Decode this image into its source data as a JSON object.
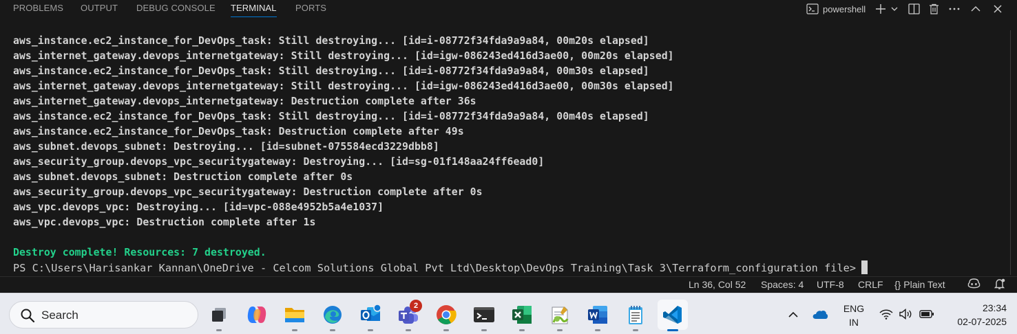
{
  "panel": {
    "tabs": [
      {
        "label": "PROBLEMS"
      },
      {
        "label": "OUTPUT"
      },
      {
        "label": "DEBUG CONSOLE"
      },
      {
        "label": "TERMINAL",
        "active": true
      },
      {
        "label": "PORTS"
      }
    ],
    "terminal_name": "powershell",
    "actions": [
      "terminal-icon",
      "plus-icon",
      "chevron-down-icon",
      "split-icon",
      "trash-icon",
      "ellipsis-icon",
      "chevron-up-icon",
      "close-icon"
    ]
  },
  "terminal": {
    "lines": [
      "aws_instance.ec2_instance_for_DevOps_task: Still destroying... [id=i-08772f34fda9a9a84, 00m20s elapsed]",
      "aws_internet_gateway.devops_internetgateway: Still destroying... [id=igw-086243ed416d3ae00, 00m20s elapsed]",
      "aws_instance.ec2_instance_for_DevOps_task: Still destroying... [id=i-08772f34fda9a9a84, 00m30s elapsed]",
      "aws_internet_gateway.devops_internetgateway: Still destroying... [id=igw-086243ed416d3ae00, 00m30s elapsed]",
      "aws_internet_gateway.devops_internetgateway: Destruction complete after 36s",
      "aws_instance.ec2_instance_for_DevOps_task: Still destroying... [id=i-08772f34fda9a9a84, 00m40s elapsed]",
      "aws_instance.ec2_instance_for_DevOps_task: Destruction complete after 49s",
      "aws_subnet.devops_subnet: Destroying... [id=subnet-075584ecd3229dbb8]",
      "aws_security_group.devops_vpc_securitygateway: Destroying... [id=sg-01f148aa24ff6ead0]",
      "aws_subnet.devops_subnet: Destruction complete after 0s",
      "aws_security_group.devops_vpc_securitygateway: Destruction complete after 0s",
      "aws_vpc.devops_vpc: Destroying... [id=vpc-088e4952b5a4e1037]",
      "aws_vpc.devops_vpc: Destruction complete after 1s",
      ""
    ],
    "success_line": "Destroy complete! Resources: 7 destroyed.",
    "prompt": "PS C:\\Users\\Harisankar Kannan\\OneDrive - Celcom Solutions Global Pvt Ltd\\Desktop\\DevOps Training\\Task 3\\Terraform_configuration file>",
    "colors": {
      "text": "#d4d4d4",
      "success": "#23d18b",
      "background": "#181818"
    }
  },
  "statusbar": {
    "position": "Ln 36, Col 52",
    "spaces": "Spaces: 4",
    "encoding": "UTF-8",
    "eol": "CRLF",
    "language_braces": "{}",
    "language": "Plain Text",
    "icons": [
      "copilot-icon",
      "bell-icon"
    ]
  },
  "taskbar": {
    "search_placeholder": "Search",
    "apps": [
      {
        "name": "task-view"
      },
      {
        "name": "copilot"
      },
      {
        "name": "file-explorer"
      },
      {
        "name": "edge"
      },
      {
        "name": "outlook"
      },
      {
        "name": "teams",
        "badge": "2"
      },
      {
        "name": "chrome"
      },
      {
        "name": "terminal"
      },
      {
        "name": "excel"
      },
      {
        "name": "notepad-plus-plus"
      },
      {
        "name": "word"
      },
      {
        "name": "notepad"
      },
      {
        "name": "vscode",
        "active": true
      }
    ],
    "tray": {
      "lang_top": "ENG",
      "lang_bottom": "IN",
      "time": "23:34",
      "date": "02-07-2025"
    }
  }
}
